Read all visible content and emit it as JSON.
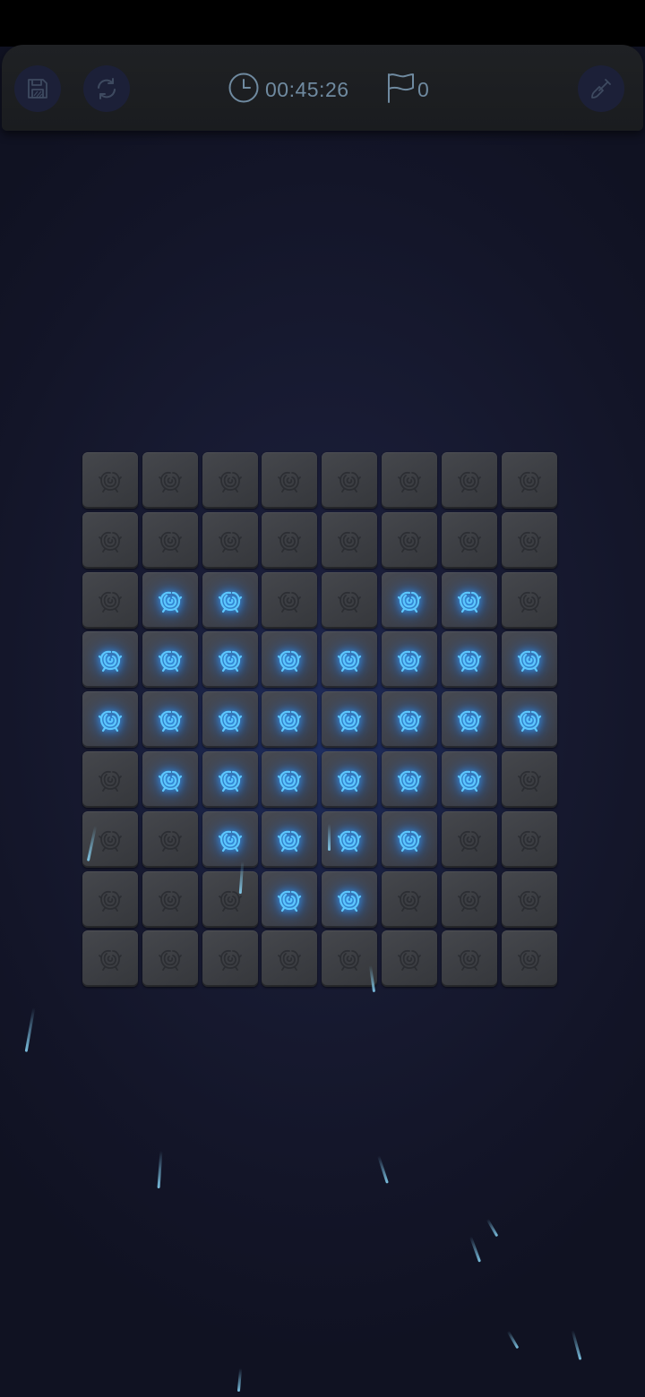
{
  "header": {
    "save_icon": "save-icon",
    "restart_icon": "restart-icon",
    "timer_icon": "clock-icon",
    "timer": "00:45:26",
    "flags_icon": "flag-icon",
    "flags_count": "0",
    "dig_icon": "shovel-icon"
  },
  "board": {
    "rows": 9,
    "cols": 8,
    "cell_icon": "rose-icon",
    "revealed": [
      [
        0,
        0,
        0,
        0,
        0,
        0,
        0,
        0
      ],
      [
        0,
        0,
        0,
        0,
        0,
        0,
        0,
        0
      ],
      [
        0,
        1,
        1,
        0,
        0,
        1,
        1,
        0
      ],
      [
        1,
        1,
        1,
        1,
        1,
        1,
        1,
        1
      ],
      [
        1,
        1,
        1,
        1,
        1,
        1,
        1,
        1
      ],
      [
        0,
        1,
        1,
        1,
        1,
        1,
        1,
        0
      ],
      [
        0,
        0,
        1,
        1,
        1,
        1,
        0,
        0
      ],
      [
        0,
        0,
        0,
        1,
        1,
        0,
        0,
        0
      ],
      [
        0,
        0,
        0,
        0,
        0,
        0,
        0,
        0
      ]
    ]
  },
  "colors": {
    "background": "#171a31",
    "topbar": "#1e2023",
    "button_bg": "#1c2038",
    "icon": "#6f8aa0",
    "tile": "#3f4146",
    "glow": "#3aa8ff",
    "rain": "#8cdcff"
  }
}
